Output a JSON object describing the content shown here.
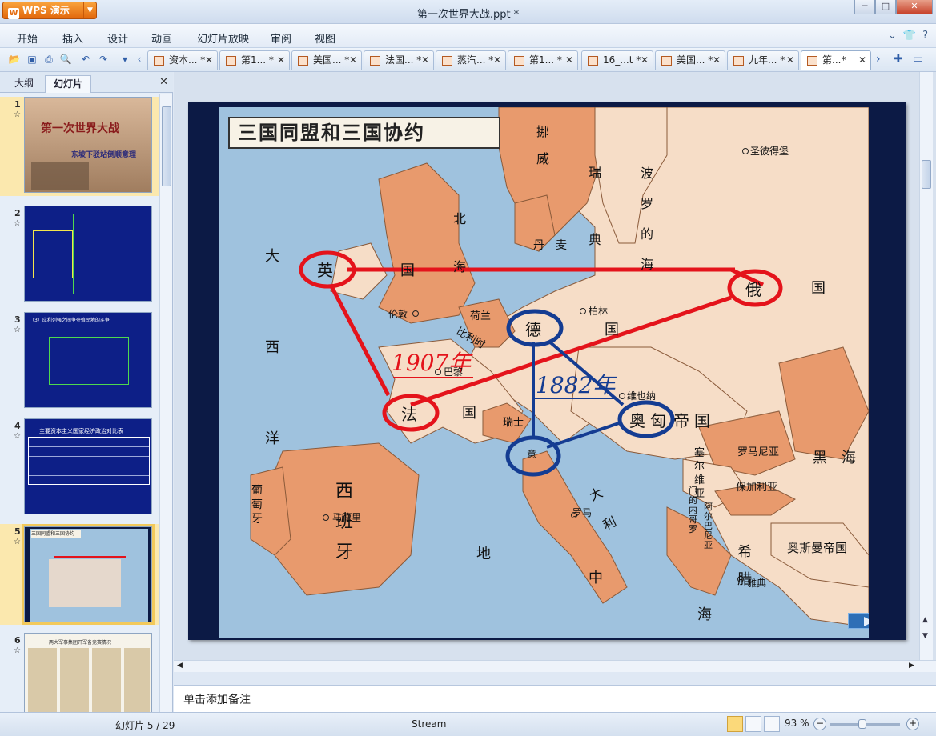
{
  "window": {
    "app_name": "WPS 演示",
    "document_title": "第一次世界大战.ppt *"
  },
  "menu": [
    "开始",
    "插入",
    "设计",
    "动画",
    "幻灯片放映",
    "审阅",
    "视图"
  ],
  "doc_tabs": [
    "资本... *",
    "第1... *",
    "美国... *",
    "法国... *",
    "蒸汽... *",
    "第1... *",
    "16_...t *",
    "美国... *",
    "九年... *",
    "第...*"
  ],
  "left_panel": {
    "tabs": [
      "大纲",
      "幻灯片"
    ],
    "slides": [
      {
        "num": "1",
        "title": "第一次世界大战",
        "subtitle": "东坡下驳站倒顺意理"
      },
      {
        "num": "2"
      },
      {
        "num": "3",
        "title": "（3）应利列强之间争夺殖民地的斗争"
      },
      {
        "num": "4",
        "title": "主要资本主义国家经济政治对比表"
      },
      {
        "num": "5",
        "title": "三国同盟和三国协约"
      },
      {
        "num": "6",
        "title": "两大军事集团开军备竞赛情况"
      }
    ]
  },
  "slide": {
    "map_title": "三国同盟和三国协约",
    "alliance_year": "1882年",
    "entente_year": "1907年",
    "entente_members": [
      "英",
      "法",
      "俄"
    ],
    "alliance_members": [
      "德",
      "奥匈",
      "意"
    ],
    "map_labels": {
      "norway": [
        "挪",
        "威"
      ],
      "sweden": [
        "瑞",
        "典"
      ],
      "baltic": [
        "波",
        "罗",
        "的",
        "海"
      ],
      "petersburg": "圣彼得堡",
      "atlantic": [
        "大",
        "西",
        "洋"
      ],
      "north_sea": [
        "北",
        "海"
      ],
      "denmark": [
        "丹",
        "麦"
      ],
      "uk": "国",
      "london": "伦敦",
      "netherlands": "荷兰",
      "belgium": "比利时",
      "berlin": "柏林",
      "germany": "国",
      "russia": "国",
      "paris": "巴黎",
      "vienna": "维也纳",
      "france": "国",
      "swiss": "瑞士",
      "austria_rest": "帝国",
      "romania": "罗马尼亚",
      "black_sea": [
        "黑",
        "海"
      ],
      "serbia": [
        "塞",
        "尔",
        "维",
        "亚"
      ],
      "bulgaria": "保加利亚",
      "portugal": [
        "葡",
        "萄",
        "牙"
      ],
      "spain": [
        "西",
        "班",
        "牙"
      ],
      "madrid": "马德里",
      "italy": [
        "大",
        "利"
      ],
      "rome": "罗马",
      "montenegro": [
        "门",
        "的",
        "内",
        "哥",
        "罗"
      ],
      "albania": [
        "阿",
        "尔",
        "巴",
        "尼",
        "亚"
      ],
      "greece": [
        "希",
        "腊"
      ],
      "athens": "雅典",
      "ottoman": "奥斯曼帝国",
      "med": [
        "地",
        "中",
        "海"
      ]
    }
  },
  "notes_placeholder": "单击添加备注",
  "status": {
    "slide_counter": "幻灯片 5 / 29",
    "theme": "Stream",
    "zoom": "93 %"
  },
  "colors": {
    "entente": "#e4131b",
    "alliance": "#143c92",
    "land": "#f6ddc7",
    "land_dark": "#e89a6d",
    "sea": "#9fc2de"
  }
}
